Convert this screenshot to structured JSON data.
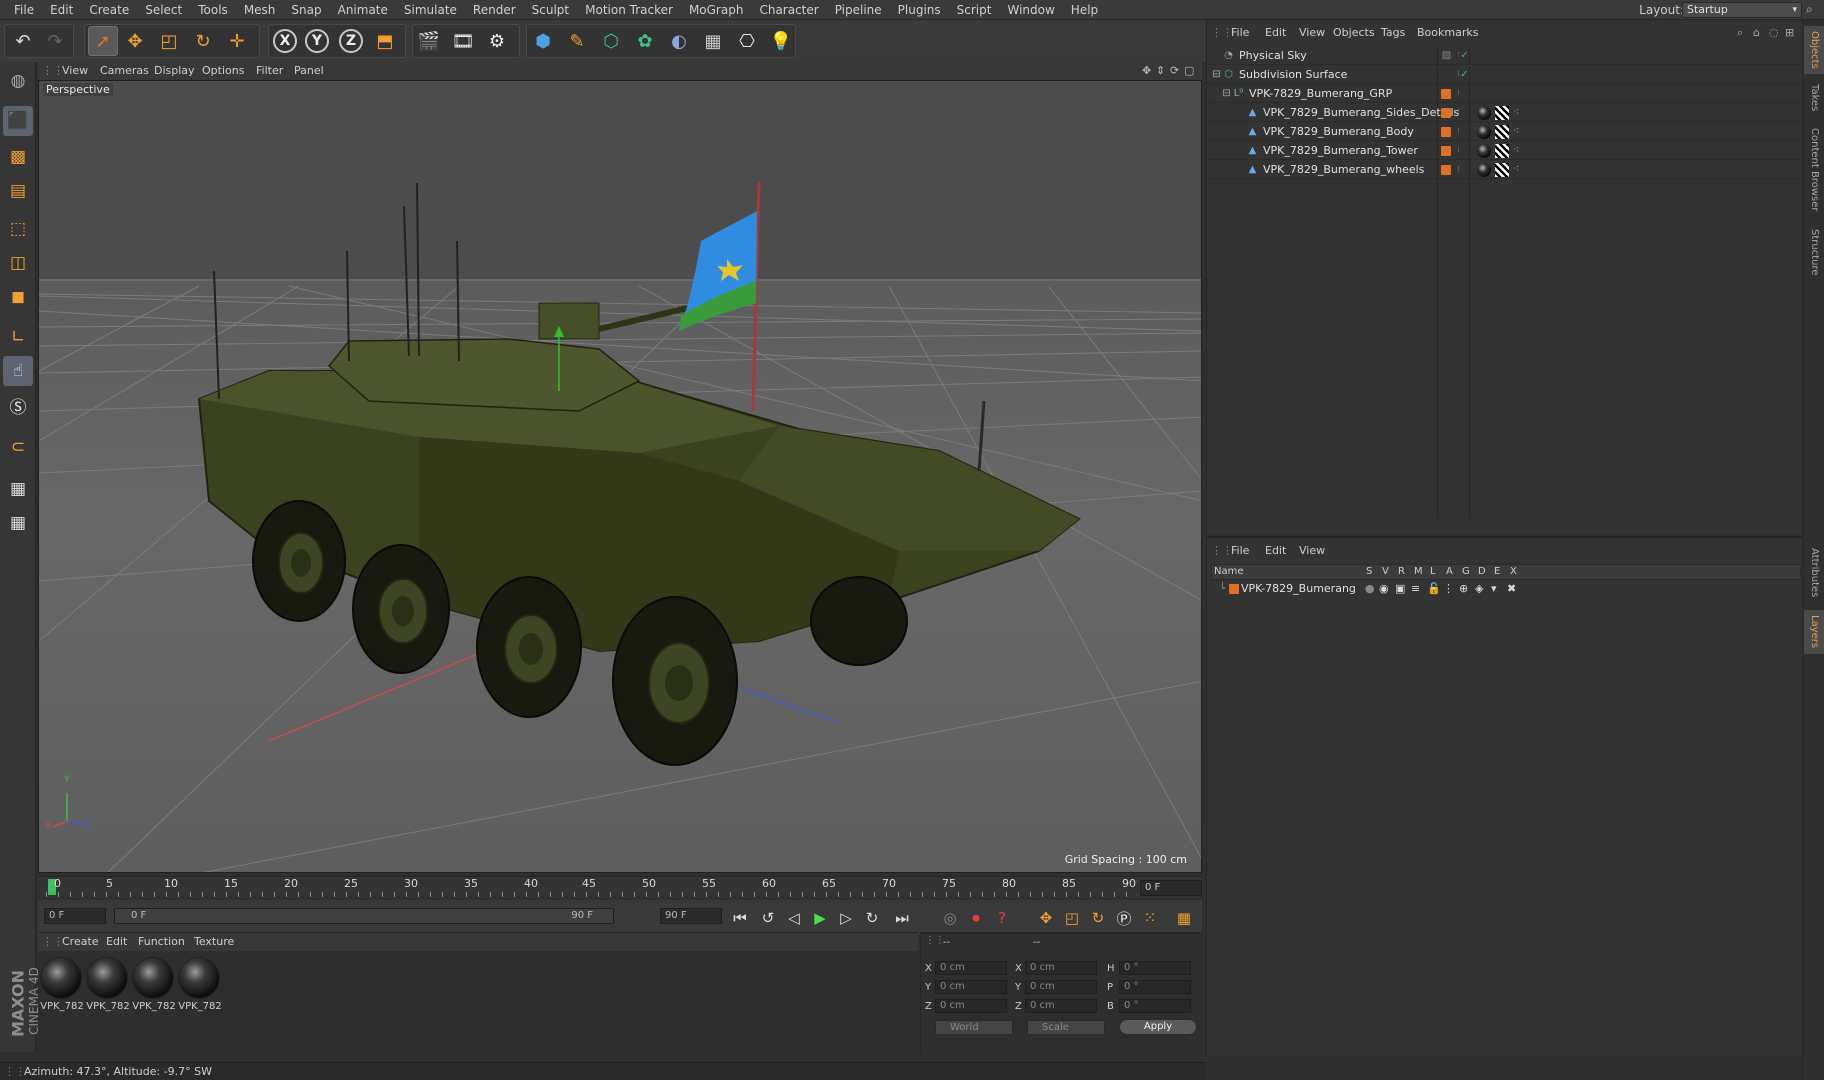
{
  "menubar": {
    "items": [
      "File",
      "Edit",
      "Create",
      "Select",
      "Tools",
      "Mesh",
      "Snap",
      "Animate",
      "Simulate",
      "Render",
      "Sculpt",
      "Motion Tracker",
      "MoGraph",
      "Character",
      "Pipeline",
      "Plugins",
      "Script",
      "Window",
      "Help"
    ],
    "layout_label": "Layout:",
    "layout_value": "Startup"
  },
  "toolbar": {
    "icons": [
      "undo-icon",
      "redo-icon",
      "select-live-icon",
      "move-icon",
      "scale-icon",
      "rotate-icon",
      "last-tool-icon",
      "x-axis-lock-icon",
      "y-axis-lock-icon",
      "z-axis-lock-icon",
      "coordinate-system-icon",
      "render-view-icon",
      "render-picture-viewer-icon",
      "render-settings-icon",
      "cube-icon",
      "pen-spline-icon",
      "subdivision-icon",
      "cloner-icon",
      "deformer-icon",
      "floor-icon",
      "camera-icon",
      "light-icon"
    ],
    "axis_labels": [
      "X",
      "Y",
      "Z"
    ]
  },
  "leftbar": {
    "icons": [
      "make-editable-icon",
      "model-mode-icon",
      "texture-mode-icon",
      "points-mode-icon",
      "edges-mode-icon",
      "polygons-mode-icon",
      "axis-mode-icon",
      "tweak-mode-icon",
      "snap-icon",
      "magnet-icon",
      "workplane-icon",
      "locked-workplane-icon"
    ],
    "brand_top": "MAXON",
    "brand_bottom": "CINEMA 4D"
  },
  "viewport": {
    "menu": [
      "View",
      "Cameras",
      "Display",
      "Options",
      "Filter",
      "Panel"
    ],
    "camera_label": "Perspective",
    "grid_spacing": "Grid Spacing : 100 cm",
    "axis_labels": {
      "x": "X",
      "y": "Y",
      "z": "Z"
    }
  },
  "timeline": {
    "ticks": [
      "0",
      "5",
      "10",
      "15",
      "20",
      "25",
      "30",
      "35",
      "40",
      "45",
      "50",
      "55",
      "60",
      "65",
      "70",
      "75",
      "80",
      "85",
      "90"
    ],
    "current_frame": "0 F"
  },
  "transport": {
    "start_field": "0 F",
    "slider_left": "0 F",
    "slider_right": "90 F",
    "end_field": "90 F"
  },
  "material_manager": {
    "menu": [
      "Create",
      "Edit",
      "Function",
      "Texture"
    ],
    "materials": [
      "VPK_782",
      "VPK_782",
      "VPK_782",
      "VPK_782"
    ]
  },
  "coordinates": {
    "header_left": "--",
    "header_right": "--",
    "rows": [
      {
        "a": "X",
        "av": "0 cm",
        "b": "X",
        "bv": "0 cm",
        "c": "H",
        "cv": "0 °"
      },
      {
        "a": "Y",
        "av": "0 cm",
        "b": "Y",
        "bv": "0 cm",
        "c": "P",
        "cv": "0 °"
      },
      {
        "a": "Z",
        "av": "0 cm",
        "b": "Z",
        "bv": "0 cm",
        "c": "B",
        "cv": "0 °"
      }
    ],
    "world_select": "World",
    "scale_select": "Scale",
    "apply_label": "Apply"
  },
  "status": {
    "text": "Azimuth: 47.3°, Altitude: -9.7°  SW"
  },
  "object_manager": {
    "menu": [
      "File",
      "Edit",
      "View",
      "Objects",
      "Tags",
      "Bookmarks"
    ],
    "objects": [
      {
        "name": "Physical Sky",
        "icon": "sky-icon"
      },
      {
        "name": "Subdivision Surface",
        "icon": "subdivision-icon"
      },
      {
        "name": "VPK-7829_Bumerang_GRP",
        "icon": "null-icon"
      },
      {
        "name": "VPK_7829_Bumerang_Sides_Details",
        "icon": "polygon-object-icon"
      },
      {
        "name": "VPK_7829_Bumerang_Body",
        "icon": "polygon-object-icon"
      },
      {
        "name": "VPK_7829_Bumerang_Tower",
        "icon": "polygon-object-icon"
      },
      {
        "name": "VPK_7829_Bumerang_wheels",
        "icon": "polygon-object-icon"
      }
    ]
  },
  "layer_manager": {
    "menu": [
      "File",
      "Edit",
      "View"
    ],
    "columns": [
      "Name",
      "S",
      "V",
      "R",
      "M",
      "L",
      "A",
      "G",
      "D",
      "E",
      "X"
    ],
    "layer_name": "VPK-7829_Bumerang"
  },
  "right_tabs": [
    "Objects",
    "Takes",
    "Content Browser",
    "Structure",
    "Attributes",
    "Layers"
  ],
  "colors": {
    "accent_orange": "#e07024",
    "selection_blue": "#5b6470",
    "vehicle_green": "#3e4722"
  }
}
